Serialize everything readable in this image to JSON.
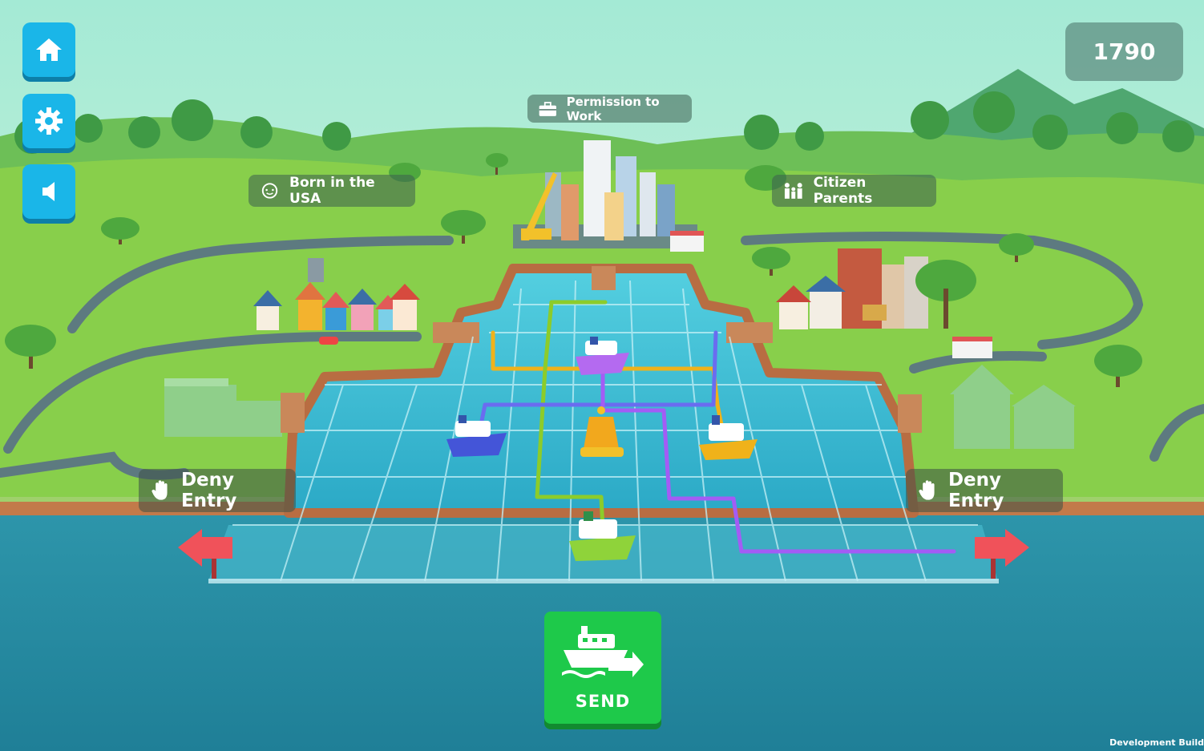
{
  "hud": {
    "score": "1790",
    "home_icon": "home-icon",
    "settings_icon": "gear-icon",
    "sound_icon": "speaker-icon"
  },
  "destinations": {
    "permission_to_work": "Permission to Work",
    "born_in_usa": "Born in the USA",
    "citizen_parents": "Citizen Parents"
  },
  "deny": {
    "left": "Deny Entry",
    "right": "Deny Entry"
  },
  "send": {
    "label": "SEND"
  },
  "footer": {
    "dev_build": "Development Build"
  },
  "colors": {
    "sky": "#9fe6cf",
    "grass": "#7cc94a",
    "water": "#2a8fa3",
    "harbor_water": "#3bb8d2",
    "button_blue": "#1ab6e8",
    "send_green": "#1ec94a",
    "route_purple": "#a35cf5",
    "route_yellow": "#f0b21a",
    "route_green": "#8ccc2a",
    "route_blue": "#6a6cf0",
    "arrow_red": "#f0525a"
  }
}
